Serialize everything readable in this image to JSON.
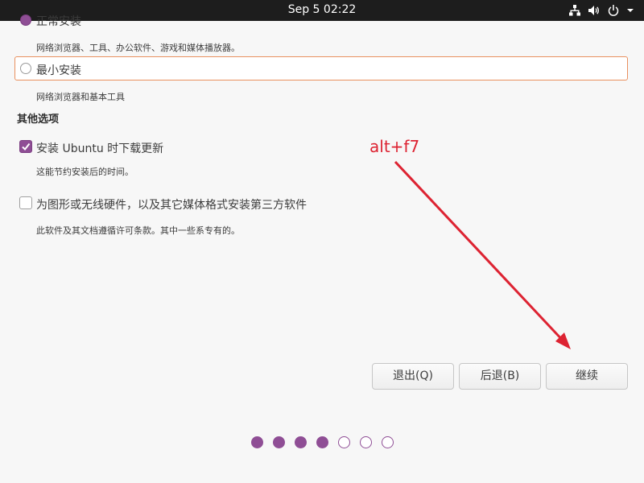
{
  "topbar": {
    "clock": "Sep 5  02:22",
    "icons": [
      "network-icon",
      "volume-icon",
      "power-icon",
      "chevron-down-icon"
    ]
  },
  "install_type": {
    "normal": {
      "label": "正常安装",
      "description": "网络浏览器、工具、办公软件、游戏和媒体播放器。",
      "selected": true
    },
    "minimal": {
      "label": "最小安装",
      "description": "网络浏览器和基本工具",
      "selected": false
    }
  },
  "other_options": {
    "title": "其他选项",
    "download_updates": {
      "label": "安装 Ubuntu 时下载更新",
      "description": "这能节约安装后的时间。",
      "checked": true
    },
    "third_party": {
      "label": "为图形或无线硬件，以及其它媒体格式安装第三方软件",
      "description": "此软件及其文档遵循许可条款。其中一些系专有的。",
      "checked": false
    }
  },
  "annotation": {
    "text": "alt+f7",
    "color": "#dd2332"
  },
  "buttons": {
    "quit": "退出(Q)",
    "back": "后退(B)",
    "continue": "继续"
  },
  "progress": {
    "total_steps": 7,
    "completed_steps": 4
  },
  "colors": {
    "accent": "#8f4e95",
    "focus": "#e9905f",
    "topbar": "#1d1d1d"
  }
}
